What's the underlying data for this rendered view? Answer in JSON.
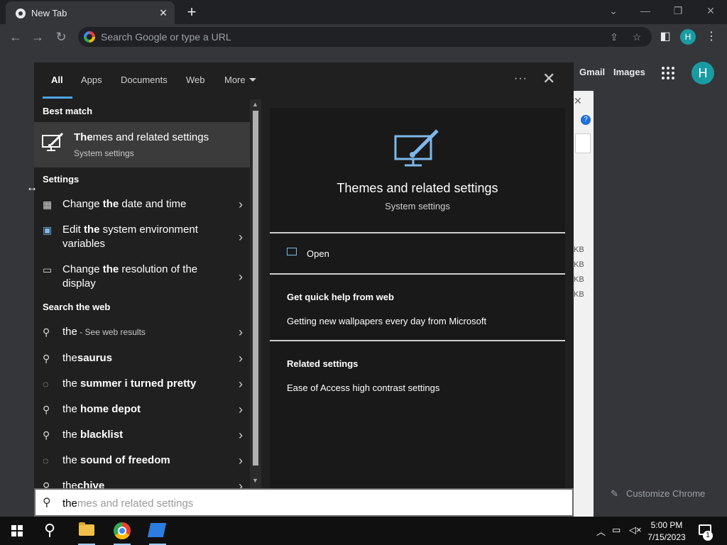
{
  "browser": {
    "tab_title": "New Tab",
    "omnibox_placeholder": "Search Google or type a URL",
    "profile_initial": "H"
  },
  "newtab": {
    "gmail": "Gmail",
    "images": "Images",
    "profile_initial": "H",
    "customize": "Customize Chrome",
    "bg_sizes": [
      "KB",
      "KB",
      "KB",
      "KB"
    ]
  },
  "search": {
    "tabs": [
      "All",
      "Apps",
      "Documents",
      "Web",
      "More"
    ],
    "best_match_heading": "Best match",
    "best_match": {
      "title_bold": "The",
      "title_rest": "mes and related settings",
      "subtitle": "System settings"
    },
    "settings_heading": "Settings",
    "settings_items": [
      {
        "pre": "Change ",
        "bold": "the",
        "post": " date and time",
        "icon": "calendar-clock-icon"
      },
      {
        "pre": "Edit ",
        "bold": "the",
        "post": " system environment variables",
        "icon": "monitor-icon"
      },
      {
        "pre": "Change ",
        "bold": "the",
        "post": " resolution of the display",
        "icon": "display-icon"
      }
    ],
    "web_heading": "Search the web",
    "web_items": [
      {
        "pre": "the",
        "bold": "",
        "small": " - See web results",
        "icon": "search-icon"
      },
      {
        "pre": "the",
        "bold": "saurus",
        "small": "",
        "icon": "search-icon"
      },
      {
        "pre": "the ",
        "bold": "summer i turned pretty",
        "small": "",
        "icon": "chat-search-icon"
      },
      {
        "pre": "the ",
        "bold": "home depot",
        "small": "",
        "icon": "search-icon"
      },
      {
        "pre": "the ",
        "bold": "blacklist",
        "small": "",
        "icon": "search-icon"
      },
      {
        "pre": "the ",
        "bold": "sound of freedom",
        "small": "",
        "icon": "chat-search-icon"
      },
      {
        "pre": "the",
        "bold": "chive",
        "small": "",
        "icon": "search-icon"
      }
    ],
    "preview": {
      "title": "Themes and related settings",
      "subtitle": "System settings",
      "open": "Open",
      "quick_help_heading": "Get quick help from web",
      "quick_help_link": "Getting new wallpapers every day from Microsoft",
      "related_heading": "Related settings",
      "related_link": "Ease of Access high contrast settings"
    },
    "query_typed": "the",
    "query_suggestion": "mes and related settings"
  },
  "taskbar": {
    "time": "5:00 PM",
    "date": "7/15/2023",
    "notification_count": "1"
  },
  "colors": {
    "accent": "#4ea5e7",
    "panel": "#202020",
    "chrome_dark": "#35363a"
  }
}
